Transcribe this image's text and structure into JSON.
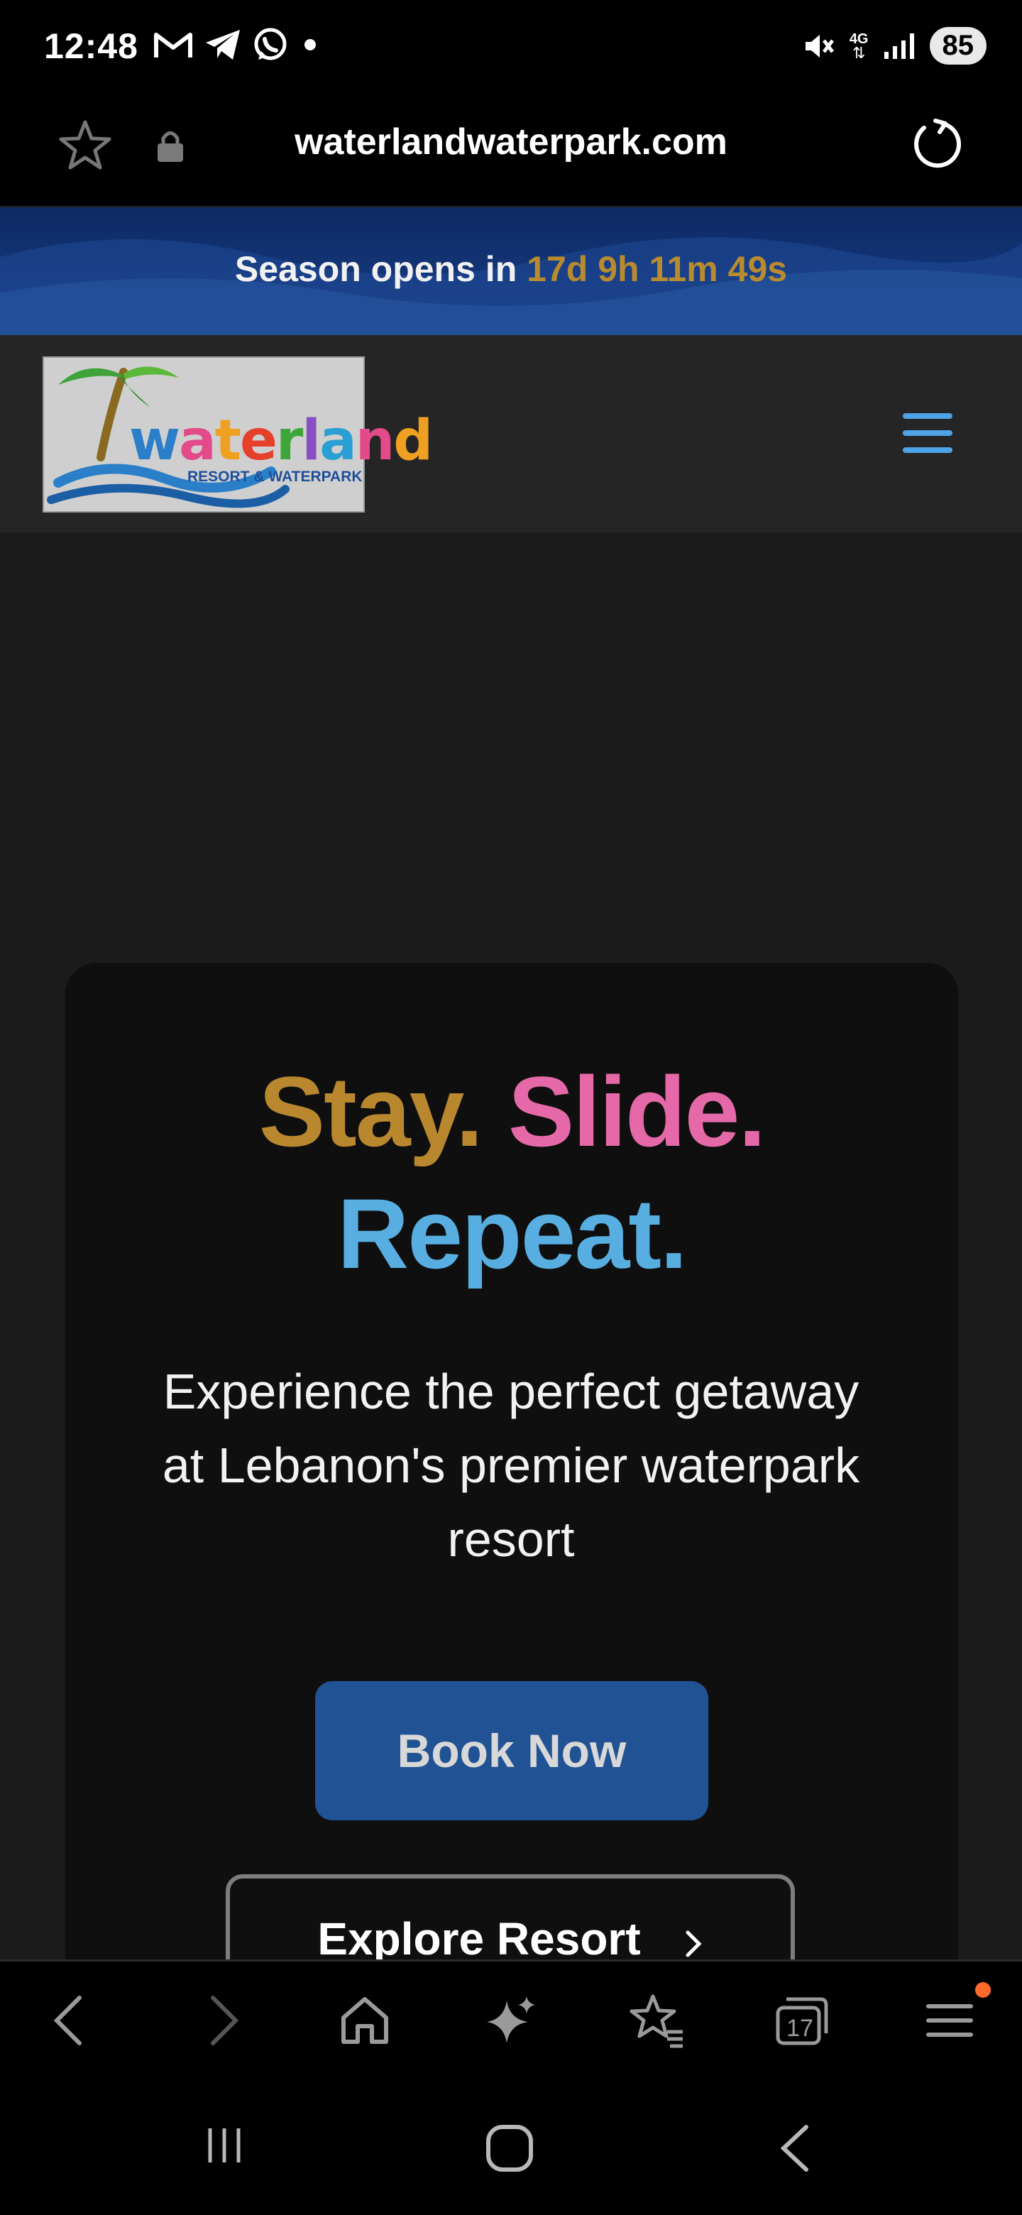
{
  "status_bar": {
    "time": "12:48",
    "battery": "85",
    "network": "4G",
    "left_icons": [
      "gmail-icon",
      "telegram-icon",
      "whatsapp-icon",
      "dot-icon"
    ],
    "right_icons": [
      "mute-icon",
      "network-4g-icon",
      "signal-icon",
      "battery-icon"
    ]
  },
  "browser": {
    "url": "waterlandwaterpark.com",
    "tab_count": "17"
  },
  "banner": {
    "prefix": "Season opens in",
    "countdown": "17d 9h 11m 49s"
  },
  "header": {
    "logo_text": "waterland",
    "logo_subtitle": "RESORT & WATERPARK"
  },
  "hero": {
    "title_word1": "Stay.",
    "title_word2": "Slide.",
    "title_word3": "Repeat.",
    "subtitle": "Experience the perfect getaway at Lebanon's premier waterpark resort",
    "book_label": "Book Now",
    "explore_label": "Explore Resort"
  },
  "colors": {
    "gold": "#b8872e",
    "pink": "#e569a8",
    "blue": "#58aee0",
    "button": "#215394",
    "banner": "#0e2a64"
  }
}
